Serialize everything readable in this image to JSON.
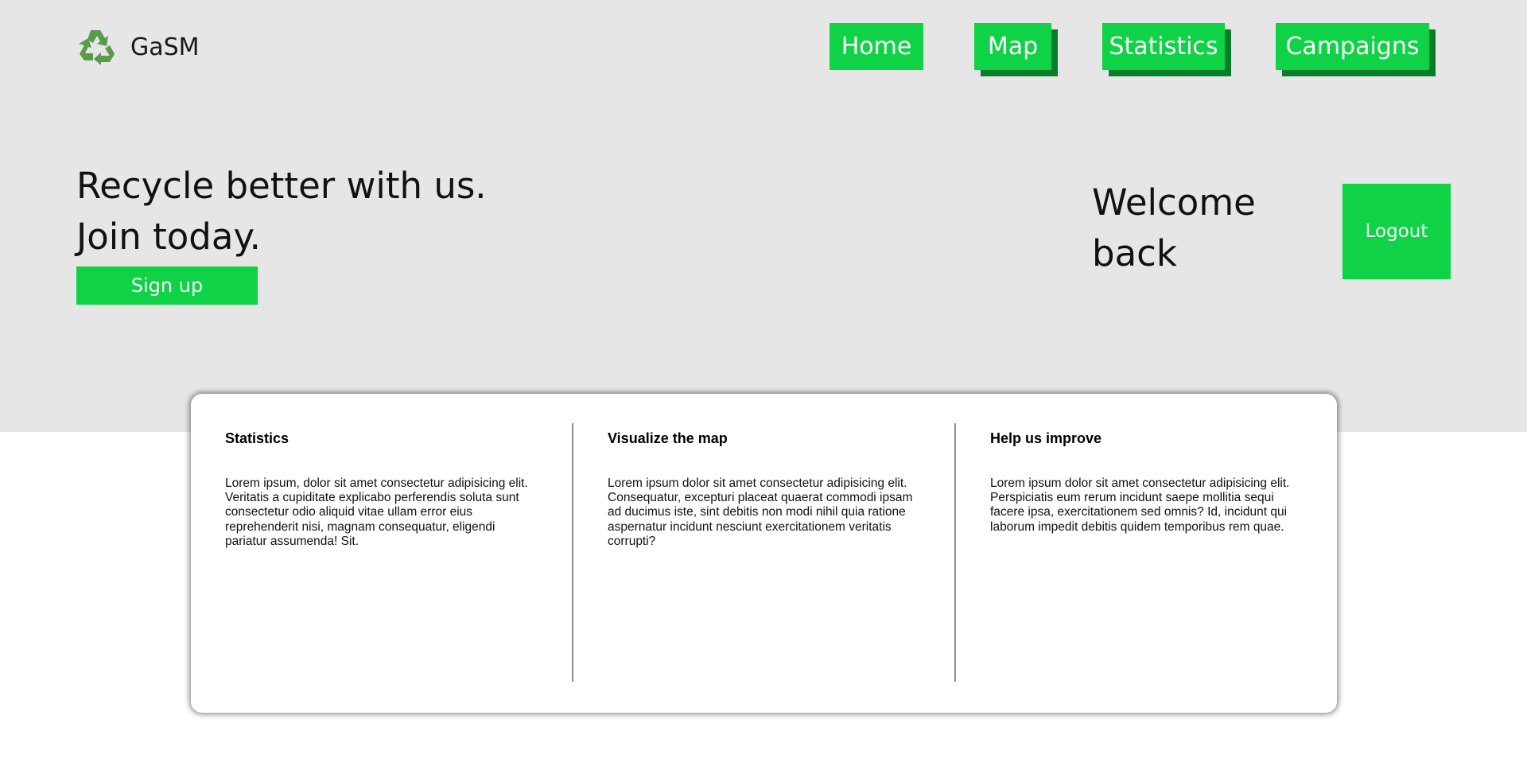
{
  "header": {
    "brand": {
      "logo_icon": "recycle-icon",
      "name": "GaSM"
    },
    "nav": [
      {
        "label": "Home"
      },
      {
        "label": "Map"
      },
      {
        "label": "Statistics"
      },
      {
        "label": "Campaigns"
      }
    ]
  },
  "hero": {
    "headline_line1": "Recycle better with us.",
    "headline_line2": "Join today.",
    "signup_label": "Sign up",
    "welcome_line1": "Welcome",
    "welcome_line2": "back",
    "logout_label": "Logout"
  },
  "features": [
    {
      "title": "Statistics",
      "text": "Lorem ipsum, dolor sit amet consectetur adipisicing elit. Veritatis a cupiditate explicabo perferendis soluta sunt consectetur odio aliquid vitae ullam error eius reprehenderit nisi, magnam consequatur, eligendi pariatur assumenda! Sit."
    },
    {
      "title": "Visualize the map",
      "text": "Lorem ipsum dolor sit amet consectetur adipisicing elit. Consequatur, excepturi placeat quaerat commodi ipsam ad ducimus iste, sint debitis non modi nihil quia ratione aspernatur incidunt nesciunt exercitationem veritatis corrupti?"
    },
    {
      "title": "Help us improve",
      "text": "Lorem ipsum dolor sit amet consectetur adipisicing elit. Perspiciatis eum rerum incidunt saepe mollitia sequi facere ipsa, exercitationem sed omnis? Id, incidunt qui laborum impedit debitis quidem temporibus rem quae."
    }
  ],
  "colors": {
    "accent_green": "#0fd246",
    "button_shadow_green": "#0a7d2a",
    "hero_background": "#e6e6e6",
    "logo_green": "#5a9a4a"
  }
}
